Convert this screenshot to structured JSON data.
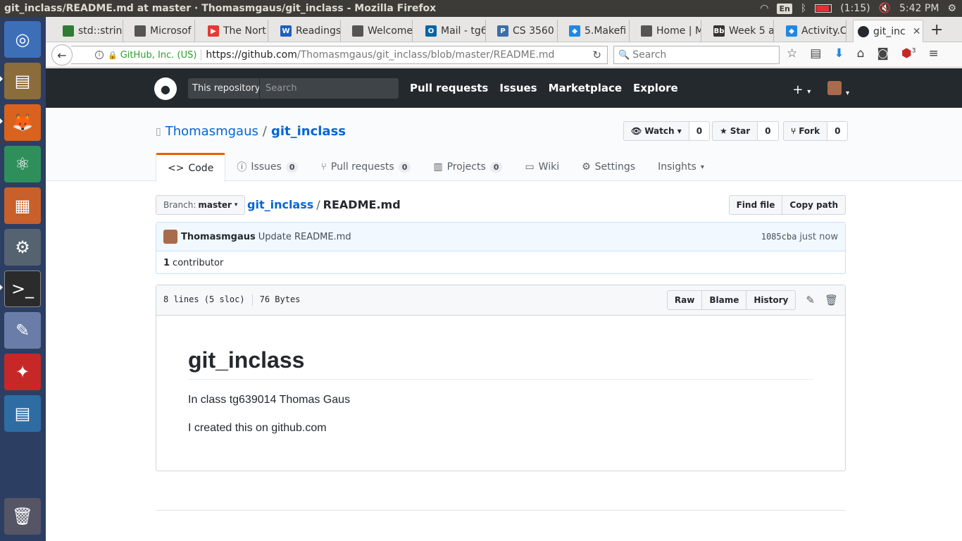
{
  "os": {
    "window_title": "git_inclass/README.md at master · Thomasmgaus/git_inclass - Mozilla Firefox",
    "keyboard": "En",
    "battery": "(1:15)",
    "clock": "5:42 PM"
  },
  "browser": {
    "tabs": [
      {
        "label": "std::strin",
        "color": "#2e7d32"
      },
      {
        "label": "Microsof",
        "color": "#444"
      },
      {
        "label": "The Nort",
        "color": "#e53935"
      },
      {
        "label": "Readings",
        "color": "#1e5fbf"
      },
      {
        "label": "Welcome",
        "color": "#444"
      },
      {
        "label": "Mail - tg6",
        "color": "#0a64a4"
      },
      {
        "label": "CS 3560 |",
        "color": "#3b6ea8"
      },
      {
        "label": "5.Makefi",
        "color": "#1e88e5"
      },
      {
        "label": "Home | M",
        "color": "#444"
      },
      {
        "label": "Week 5 a",
        "color": "#333"
      },
      {
        "label": "Activity.C",
        "color": "#1e88e5"
      },
      {
        "label": "git_inc",
        "color": "#24292e"
      }
    ],
    "url_org": "GitHub, Inc. (US)",
    "url_host": "https://github.com",
    "url_path": "/Thomasmgaus/git_inclass/blob/master/README.md",
    "search_placeholder": "Search",
    "ublock_count": "3"
  },
  "github": {
    "scope_label": "This repository",
    "search_placeholder": "Search",
    "nav": [
      "Pull requests",
      "Issues",
      "Marketplace",
      "Explore"
    ],
    "owner": "Thomasmgaus",
    "repo": "git_inclass",
    "watch_label": "Watch",
    "watch_count": "0",
    "star_label": "Star",
    "star_count": "0",
    "fork_label": "Fork",
    "fork_count": "0",
    "tabs": {
      "code": "Code",
      "issues": "Issues",
      "issues_count": "0",
      "pulls": "Pull requests",
      "pulls_count": "0",
      "projects": "Projects",
      "projects_count": "0",
      "wiki": "Wiki",
      "settings": "Settings",
      "insights": "Insights"
    },
    "branch_prefix": "Branch:",
    "branch": "master",
    "breadcrumb_repo": "git_inclass",
    "breadcrumb_file": "README.md",
    "find_file": "Find file",
    "copy_path": "Copy path",
    "commit": {
      "author": "Thomasmgaus",
      "message": "Update README.md",
      "sha": "1085cba",
      "when": "just now",
      "contributors_count": "1",
      "contributors_label": "contributor"
    },
    "file": {
      "lines": "8 lines (5 sloc)",
      "size": "76 Bytes",
      "raw": "Raw",
      "blame": "Blame",
      "history": "History"
    },
    "readme": {
      "heading": "git_inclass",
      "paragraphs": [
        "In class tg639014 Thomas Gaus",
        "I created this on github.com"
      ]
    }
  }
}
